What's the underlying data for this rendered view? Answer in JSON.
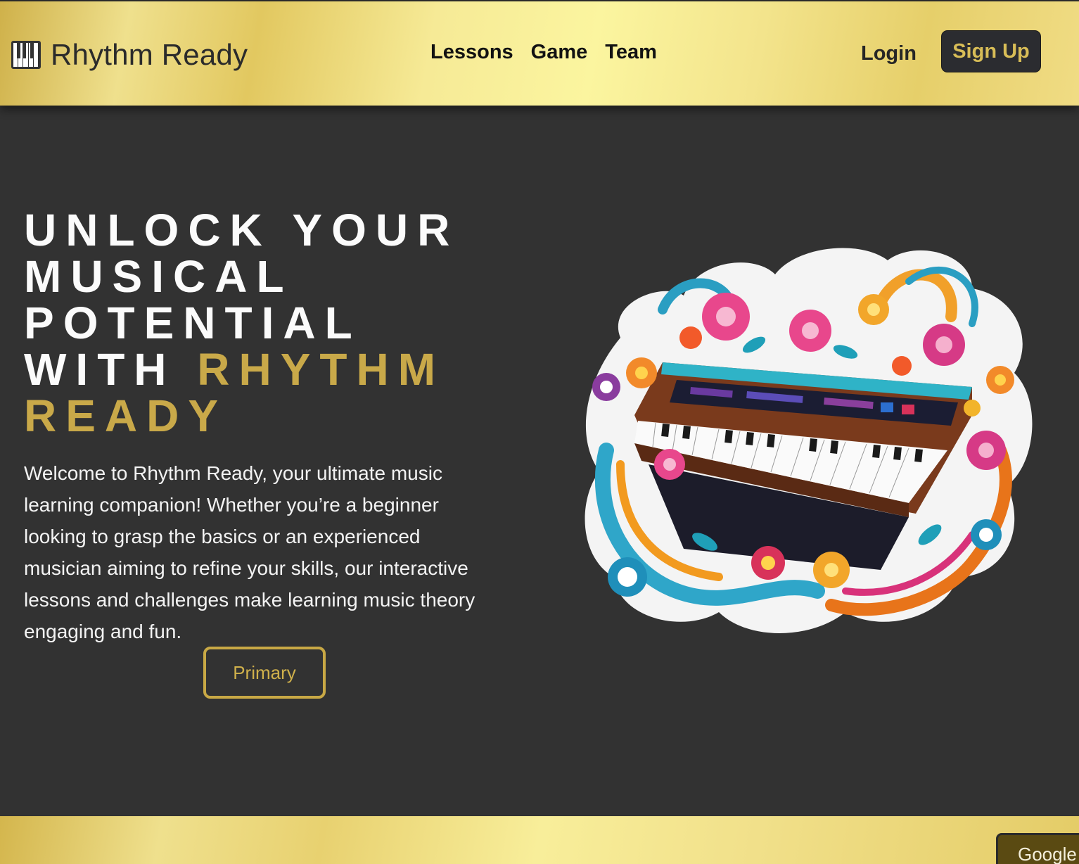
{
  "header": {
    "brand": "Rhythm Ready",
    "nav": [
      "Lessons",
      "Game",
      "Team"
    ],
    "login": "Login",
    "signup": "Sign Up"
  },
  "hero": {
    "title_lines": [
      "UNLOCK YOUR",
      "MUSICAL",
      "POTENTIAL",
      "WITH"
    ],
    "title_accent_inline": "RHYTHM",
    "title_accent_line": "READY",
    "body": "Welcome to Rhythm Ready, your ultimate music learning companion! Whether you’re a beginner looking to grasp the basics or an experienced musician aiming to refine your skills, our interactive lessons and challenges make learning music theory engaging and fun.",
    "button": "Primary",
    "image_icon": "colorful-piano-illustration"
  },
  "footer": {
    "google_button": "Google"
  },
  "colors": {
    "background": "#323232",
    "accent_gold": "#c9a949",
    "signup_bg": "#2b2c30"
  }
}
